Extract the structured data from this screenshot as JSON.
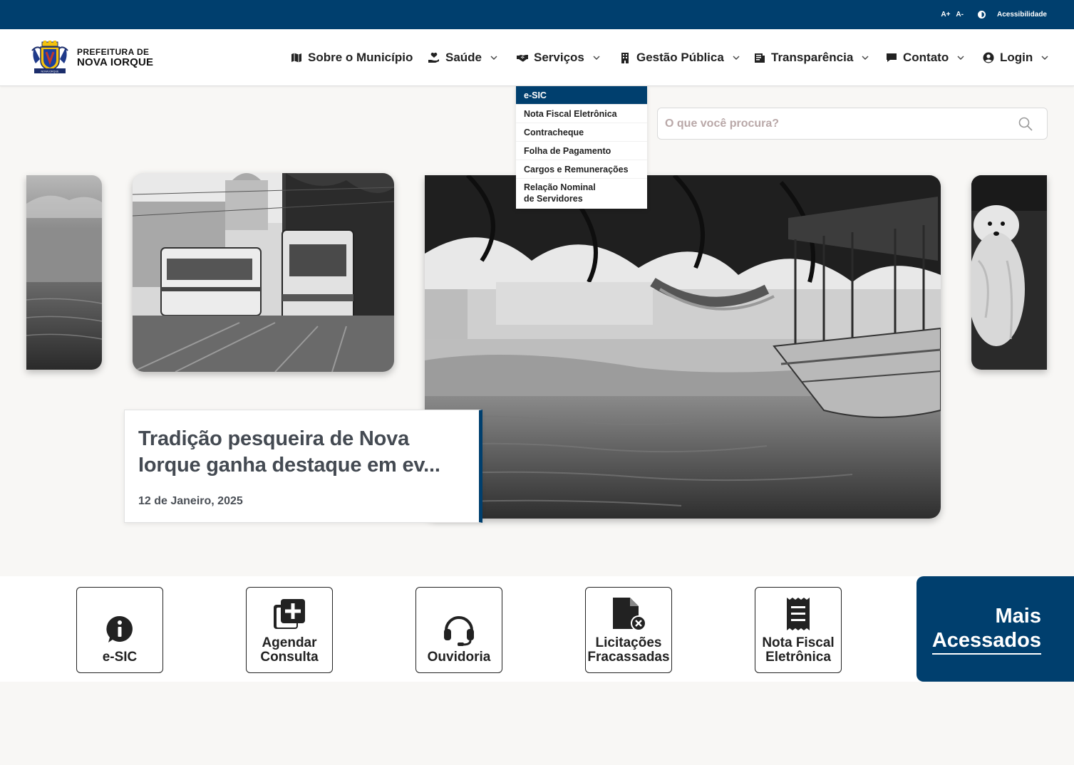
{
  "topbar": {
    "font_increase": "A+",
    "font_decrease": "A-",
    "contrast_icon": "contrast-icon",
    "accessibility": "Acessibilidade",
    "bg_color": "#003f6e"
  },
  "logo": {
    "line1": "PREFEITURA DE",
    "line2": "NOVA IORQUE",
    "crest_text": "NOVA IORQUE"
  },
  "nav": {
    "items": [
      {
        "label": "Sobre o Município",
        "icon": "map-icon",
        "has_dropdown": false
      },
      {
        "label": "Saúde",
        "icon": "hand-heart-icon",
        "has_dropdown": true
      },
      {
        "label": "Serviços",
        "icon": "handshake-icon",
        "has_dropdown": true
      },
      {
        "label": "Gestão Pública",
        "icon": "building-icon",
        "has_dropdown": true
      },
      {
        "label": "Transparência",
        "icon": "document-icon",
        "has_dropdown": true
      },
      {
        "label": "Contato",
        "icon": "chat-icon",
        "has_dropdown": true
      },
      {
        "label": "Login",
        "icon": "user-circle-icon",
        "has_dropdown": true
      }
    ]
  },
  "services_dropdown": {
    "items": [
      {
        "label": "e-SIC",
        "active": true
      },
      {
        "label": "Nota Fiscal Eletrônica",
        "active": false
      },
      {
        "label": "Contracheque",
        "active": false
      },
      {
        "label": "Folha de Pagamento",
        "active": false
      },
      {
        "label": "Cargos e Remunerações",
        "active": false
      },
      {
        "label": "Relação Nominal\nde Servidores",
        "active": false
      }
    ]
  },
  "search": {
    "placeholder": "O que você procura?",
    "value": ""
  },
  "carousel": {
    "featured": {
      "title": "Tradição pesqueira de Nova Iorque ganha destaque em ev...",
      "date": "12 de Janeiro, 2025"
    }
  },
  "quick_access": {
    "items": [
      {
        "label": "e-SIC",
        "icon": "info-chat-icon"
      },
      {
        "label": "Agendar\nConsulta",
        "icon": "add-copy-icon"
      },
      {
        "label": "Ouvidoria",
        "icon": "headset-icon"
      },
      {
        "label": "Licitações\nFracassadas",
        "icon": "file-x-icon"
      },
      {
        "label": "Nota Fiscal\nEletrônica",
        "icon": "receipt-icon"
      }
    ],
    "more_line1": "Mais",
    "more_line2": "Acessados"
  }
}
